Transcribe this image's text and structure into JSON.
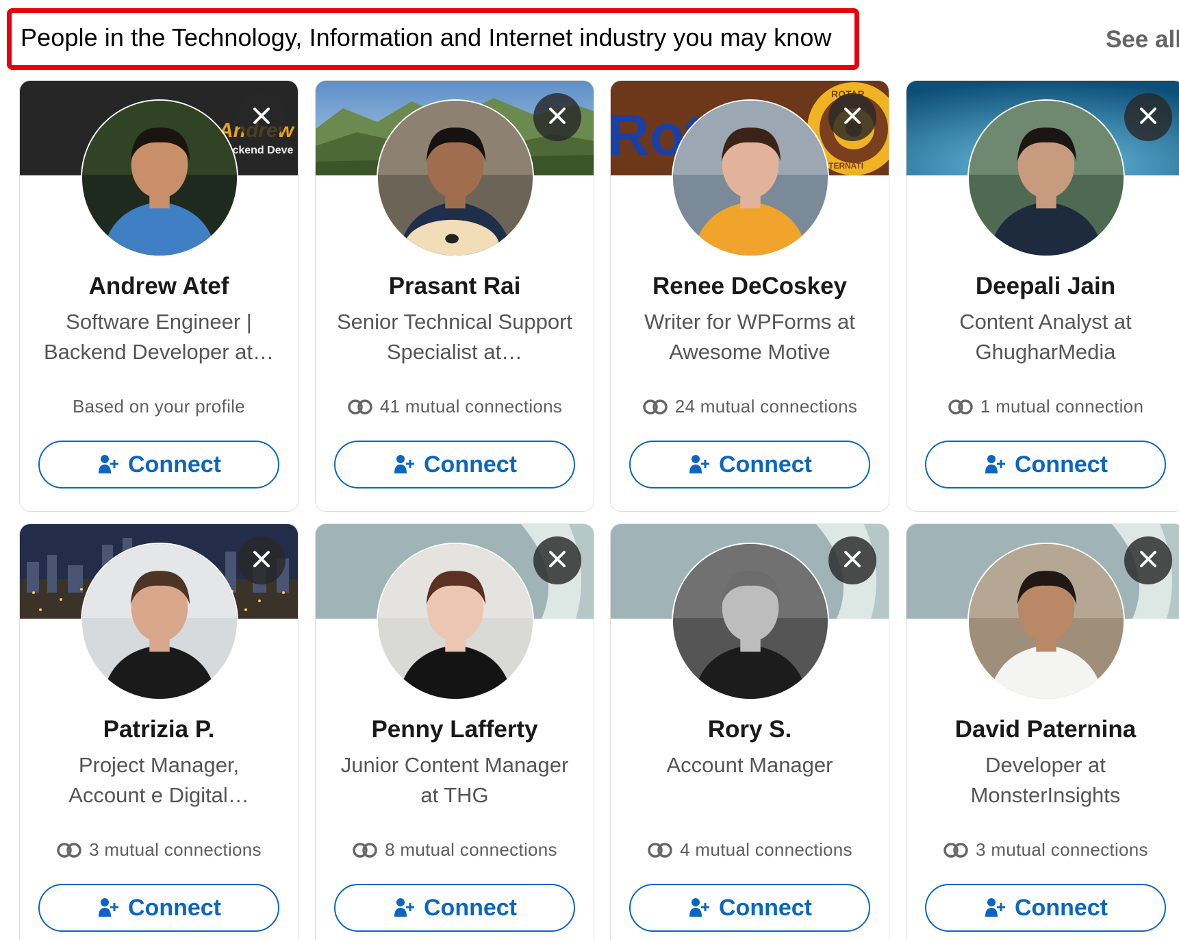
{
  "section": {
    "title": "People in the Technology, Information and Internet industry you may know",
    "see_all": "See all"
  },
  "colors": {
    "highlight": "#e8000b",
    "link_blue": "#0a66c2",
    "dismiss_bg": "#333333"
  },
  "icons": {
    "dismiss": "close-icon",
    "mutual": "mutual-connections-icon",
    "connect": "add-person-icon"
  },
  "cards": [
    {
      "name": "Andrew Atef",
      "headline": "Software Engineer | Backend Developer at…",
      "insight": "Based on your profile",
      "show_mutual_icon": false,
      "button": "Connect",
      "banner": "dark-nameplate",
      "banner_text": [
        "Andrew A",
        "Backend Deve"
      ]
    },
    {
      "name": "Prasant Rai",
      "headline": "Senior Technical Support Specialist at…",
      "insight": "41 mutual connections",
      "show_mutual_icon": true,
      "button": "Connect",
      "banner": "mountains",
      "banner_text": []
    },
    {
      "name": "Renee DeCoskey",
      "headline": "Writer for WPForms at Awesome Motive",
      "insight": "24 mutual connections",
      "show_mutual_icon": true,
      "button": "Connect",
      "banner": "rotary",
      "banner_text": [
        "Rot",
        "ROTAR",
        "TERNATI"
      ]
    },
    {
      "name": "Deepali Jain",
      "headline": "Content Analyst at GhugharMedia",
      "insight": "1 mutual connection",
      "show_mutual_icon": true,
      "button": "Connect",
      "banner": "blue-gradient",
      "banner_text": []
    },
    {
      "name": "Patrizia P.",
      "headline": "Project Manager, Account e Digital…",
      "insight": "3 mutual connections",
      "show_mutual_icon": true,
      "button": "Connect",
      "banner": "city-night",
      "banner_text": []
    },
    {
      "name": "Penny Lafferty",
      "headline": "Junior Content Manager at THG",
      "insight": "8 mutual connections",
      "show_mutual_icon": true,
      "button": "Connect",
      "banner": "default-grey",
      "banner_text": []
    },
    {
      "name": "Rory S.",
      "headline": "Account Manager",
      "insight": "4 mutual connections",
      "show_mutual_icon": true,
      "button": "Connect",
      "banner": "default-grey",
      "banner_text": []
    },
    {
      "name": "David Paternina",
      "headline": "Developer at MonsterInsights",
      "insight": "3 mutual connections",
      "show_mutual_icon": true,
      "button": "Connect",
      "banner": "default-grey",
      "banner_text": []
    }
  ]
}
